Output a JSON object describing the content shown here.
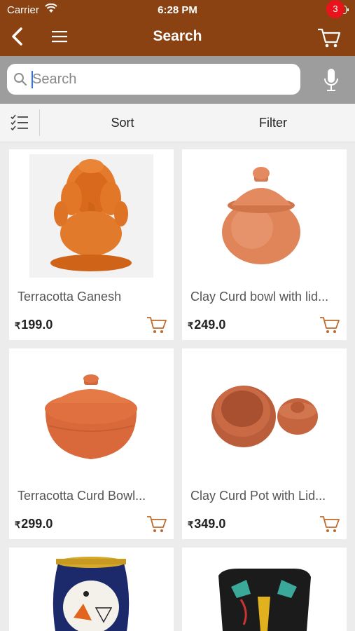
{
  "status": {
    "carrier": "Carrier",
    "time": "6:28 PM"
  },
  "nav": {
    "title": "Search",
    "cart_count": "3"
  },
  "search": {
    "placeholder": "Search",
    "value": ""
  },
  "sortbar": {
    "sort_label": "Sort",
    "filter_label": "Filter"
  },
  "products": [
    {
      "name": "Terracotta Ganesh",
      "currency": "₹",
      "price": "199.0"
    },
    {
      "name": "Clay Curd bowl with lid...",
      "currency": "₹",
      "price": "249.0"
    },
    {
      "name": "Terracotta Curd Bowl...",
      "currency": "₹",
      "price": "299.0"
    },
    {
      "name": "Clay Curd Pot with Lid...",
      "currency": "₹",
      "price": "349.0"
    },
    {
      "name": "",
      "currency": "",
      "price": ""
    },
    {
      "name": "",
      "currency": "",
      "price": ""
    }
  ],
  "colors": {
    "header": "#8a4213",
    "badge": "#e9141b",
    "accent": "#c0692b"
  },
  "icons": [
    "back-icon",
    "menu-icon",
    "cart-icon",
    "search-icon",
    "mic-icon",
    "list-icon",
    "add-to-cart-icon"
  ]
}
